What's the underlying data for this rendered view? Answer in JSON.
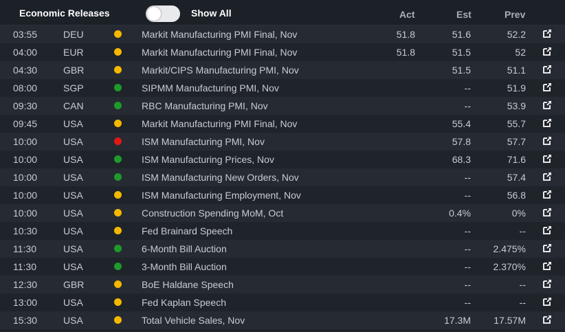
{
  "header": {
    "title": "Economic Releases",
    "toggle_state": "off",
    "toggle_label": "Show All",
    "columns": {
      "act": "Act",
      "est": "Est",
      "prev": "Prev"
    }
  },
  "colors": {
    "yellow": "#f5b800",
    "green": "#1f9a2c",
    "red": "#e01818"
  },
  "icons": {
    "row_link": "external-link-icon",
    "impact": "impact-dot-icon"
  },
  "releases": [
    {
      "time": "03:55",
      "country": "DEU",
      "impact": "yellow",
      "event": "Markit Manufacturing PMI Final, Nov",
      "act": "51.8",
      "est": "51.6",
      "prev": "52.2"
    },
    {
      "time": "04:00",
      "country": "EUR",
      "impact": "yellow",
      "event": "Markit Manufacturing PMI Final, Nov",
      "act": "51.8",
      "est": "51.5",
      "prev": "52"
    },
    {
      "time": "04:30",
      "country": "GBR",
      "impact": "yellow",
      "event": "Markit/CIPS Manufacturing PMI, Nov",
      "act": "",
      "est": "51.5",
      "prev": "51.1"
    },
    {
      "time": "08:00",
      "country": "SGP",
      "impact": "green",
      "event": "SIPMM Manufacturing PMI, Nov",
      "act": "",
      "est": "--",
      "prev": "51.9"
    },
    {
      "time": "09:30",
      "country": "CAN",
      "impact": "green",
      "event": "RBC Manufacturing PMI, Nov",
      "act": "",
      "est": "--",
      "prev": "53.9"
    },
    {
      "time": "09:45",
      "country": "USA",
      "impact": "yellow",
      "event": "Markit Manufacturing PMI Final, Nov",
      "act": "",
      "est": "55.4",
      "prev": "55.7"
    },
    {
      "time": "10:00",
      "country": "USA",
      "impact": "red",
      "event": "ISM Manufacturing PMI, Nov",
      "act": "",
      "est": "57.8",
      "prev": "57.7"
    },
    {
      "time": "10:00",
      "country": "USA",
      "impact": "green",
      "event": "ISM Manufacturing Prices, Nov",
      "act": "",
      "est": "68.3",
      "prev": "71.6"
    },
    {
      "time": "10:00",
      "country": "USA",
      "impact": "green",
      "event": "ISM Manufacturing New Orders, Nov",
      "act": "",
      "est": "--",
      "prev": "57.4"
    },
    {
      "time": "10:00",
      "country": "USA",
      "impact": "yellow",
      "event": "ISM Manufacturing Employment, Nov",
      "act": "",
      "est": "--",
      "prev": "56.8"
    },
    {
      "time": "10:00",
      "country": "USA",
      "impact": "yellow",
      "event": "Construction Spending MoM, Oct",
      "act": "",
      "est": "0.4%",
      "prev": "0%"
    },
    {
      "time": "10:30",
      "country": "USA",
      "impact": "yellow",
      "event": "Fed Brainard Speech",
      "act": "",
      "est": "--",
      "prev": "--"
    },
    {
      "time": "11:30",
      "country": "USA",
      "impact": "green",
      "event": "6-Month Bill Auction",
      "act": "",
      "est": "--",
      "prev": "2.475%"
    },
    {
      "time": "11:30",
      "country": "USA",
      "impact": "green",
      "event": "3-Month Bill Auction",
      "act": "",
      "est": "--",
      "prev": "2.370%"
    },
    {
      "time": "12:30",
      "country": "GBR",
      "impact": "yellow",
      "event": "BoE Haldane Speech",
      "act": "",
      "est": "--",
      "prev": "--"
    },
    {
      "time": "13:00",
      "country": "USA",
      "impact": "yellow",
      "event": "Fed Kaplan Speech",
      "act": "",
      "est": "--",
      "prev": "--"
    },
    {
      "time": "15:30",
      "country": "USA",
      "impact": "yellow",
      "event": "Total Vehicle Sales, Nov",
      "act": "",
      "est": "17.3M",
      "prev": "17.57M"
    }
  ]
}
